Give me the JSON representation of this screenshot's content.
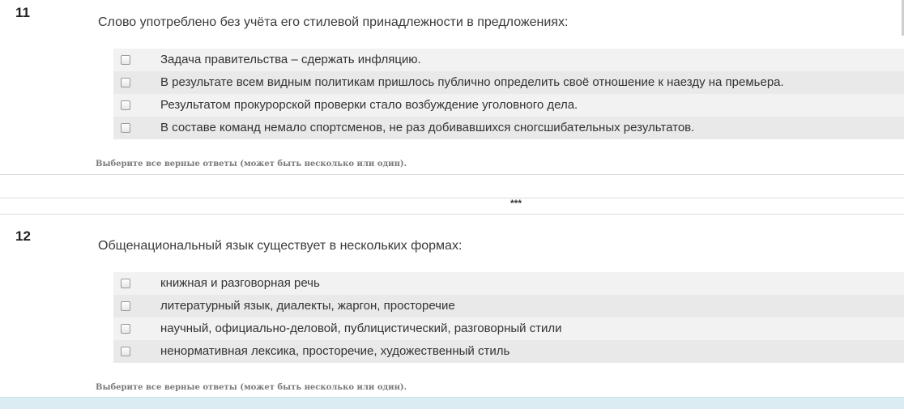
{
  "questions": [
    {
      "number": "11",
      "text": "Слово употреблено без учёта его стилевой принадлежности в предложениях:",
      "options": [
        "Задача правительства – сдержать инфляцию.",
        "В результате всем видным политикам пришлось публично определить своё отношение к наезду на премьера.",
        "Результатом прокурорской проверки стало возбуждение уголовного дела.",
        "В составе команд немало спортсменов, не раз добивавшихся сногсшибательных результатов."
      ],
      "hint": "Выберите все верные ответы (может быть несколько или один)."
    },
    {
      "number": "12",
      "text": "Общенациональный язык существует в нескольких формах:",
      "options": [
        "книжная и разговорная речь",
        "литературный язык, диалекты, жаргон, просторечие",
        "научный, официально-деловой, публицистический, разговорный стили",
        "ненормативная лексика, просторечие, художественный стиль"
      ],
      "hint": "Выберите все верные ответы (может быть несколько или один)."
    }
  ],
  "separator": "***"
}
